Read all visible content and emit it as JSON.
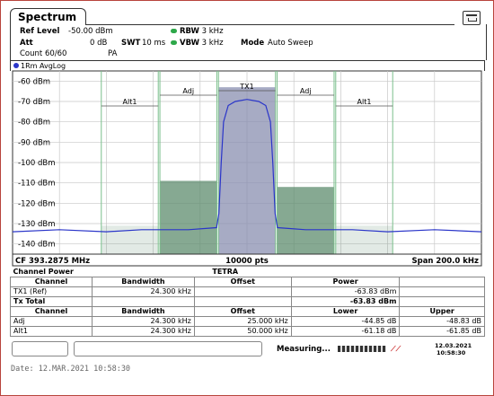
{
  "window": {
    "tab": "Spectrum"
  },
  "settings": {
    "ref_level_label": "Ref Level",
    "ref_level_value": "-50.00 dBm",
    "att_label": "Att",
    "att_value": "0 dB",
    "swt_label": "SWT",
    "swt_value": "10 ms",
    "rbw_label": "RBW",
    "rbw_value": "3 kHz",
    "vbw_label": "VBW",
    "vbw_value": "3 kHz",
    "mode_label": "Mode",
    "mode_value": "Auto Sweep",
    "count": "Count 60/60",
    "pa": "PA"
  },
  "plot": {
    "trace_label": "1Rm AvgLog",
    "y_ticks": [
      "-60 dBm",
      "-70 dBm",
      "-80 dBm",
      "-90 dBm",
      "-100 dBm",
      "-110 dBm",
      "-120 dBm",
      "-130 dBm",
      "-140 dBm"
    ],
    "channel_labels": {
      "alt1_left": "Alt1",
      "adj_left": "Adj",
      "tx1": "TX1",
      "adj_right": "Adj",
      "alt1_right": "Alt1"
    },
    "cf": "CF 393.2875 MHz",
    "points": "10000 pts",
    "span": "Span 200.0 kHz",
    "colors": {
      "trace": "#2a35c9",
      "channel_fill": "#5e8c6e",
      "tx_fill": "#8a8fb0",
      "grid": "#c8c8c8",
      "bg": "#ffffff"
    }
  },
  "chart_data": {
    "type": "line",
    "xlabel": "",
    "ylabel": "",
    "xlim_khz": [
      -100,
      100
    ],
    "ylim_dbm": [
      -145,
      -55
    ],
    "series": [
      {
        "x_khz": [
          -100,
          -80,
          -60,
          -45,
          -25,
          -13,
          -12,
          -11,
          -10,
          -8,
          -5,
          0,
          5,
          8,
          10,
          11,
          12,
          13,
          25,
          45,
          60,
          80,
          100
        ],
        "y_dbm": [
          -134,
          -133,
          -134,
          -133,
          -133,
          -132,
          -125,
          -100,
          -80,
          -72,
          -70,
          -69,
          -70,
          -72,
          -80,
          -100,
          -125,
          -132,
          -133,
          -133,
          -134,
          -133,
          -134
        ]
      }
    ],
    "channel_power_bars": [
      {
        "name": "Alt1",
        "x_khz": [
          -62.15,
          -37.85
        ],
        "y_dbm": -131
      },
      {
        "name": "Adj",
        "x_khz": [
          -37.15,
          -12.85
        ],
        "y_dbm": -109
      },
      {
        "name": "TX1",
        "x_khz": [
          -12.15,
          12.15
        ],
        "y_dbm": -63
      },
      {
        "name": "Adj",
        "x_khz": [
          12.85,
          37.15
        ],
        "y_dbm": -112
      },
      {
        "name": "Alt1",
        "x_khz": [
          37.85,
          62.15
        ],
        "y_dbm": -131
      }
    ]
  },
  "table": {
    "title": "Channel Power",
    "standard": "TETRA",
    "head1": [
      "Channel",
      "Bandwidth",
      "Offset",
      "Power",
      ""
    ],
    "tx_rows": [
      [
        "TX1 (Ref)",
        "24.300 kHz",
        "",
        "-63.83 dBm",
        ""
      ]
    ],
    "tx_total_label": "Tx Total",
    "tx_total_value": "-63.83 dBm",
    "head2": [
      "Channel",
      "Bandwidth",
      "Offset",
      "Lower",
      "Upper"
    ],
    "adj_rows": [
      [
        "Adj",
        "24.300 kHz",
        "25.000 kHz",
        "-44.85 dB",
        "-48.83 dB"
      ],
      [
        "Alt1",
        "24.300 kHz",
        "50.000 kHz",
        "-61.18 dB",
        "-61.85 dB"
      ]
    ]
  },
  "status": {
    "measuring": "Measuring...",
    "date": "12.03.2021",
    "time": "10:58:30"
  },
  "footer": {
    "date_line": "Date: 12.MAR.2021  10:58:30"
  }
}
